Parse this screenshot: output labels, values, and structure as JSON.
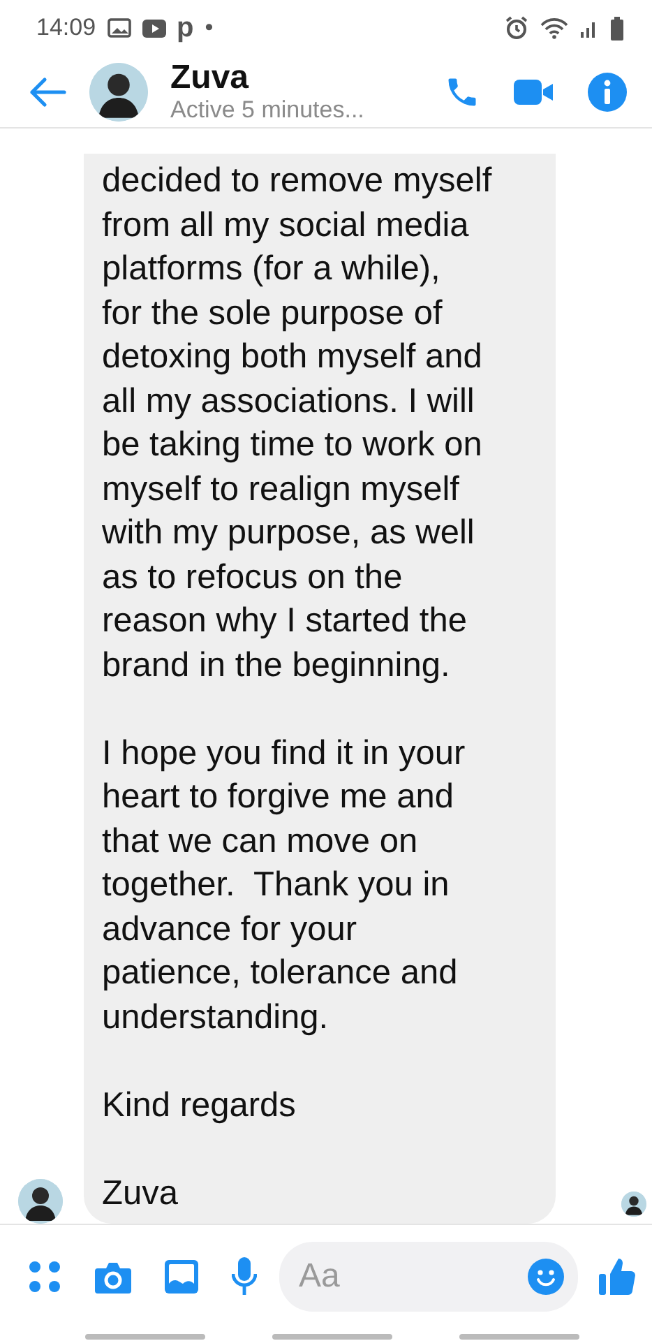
{
  "status_bar": {
    "time": "14:09",
    "app_letter": "p",
    "dot": "•"
  },
  "header": {
    "name": "Zuva",
    "presence": "Active 5 minutes..."
  },
  "message": {
    "paragraphs": [
      [
        "decided to remove myself",
        "from all my social media",
        "platforms (for a while),",
        "for the sole purpose of",
        "detoxing both myself and",
        "all my associations. I will",
        "be taking time to work on",
        "myself to realign myself",
        "with my purpose, as well",
        "as to refocus on the",
        "reason why I started the",
        "brand in the beginning."
      ],
      [
        "I hope you find it in your",
        "heart to forgive me and",
        "that we can move on",
        "together.  Thank you in",
        "advance for your",
        "patience, tolerance and",
        "understanding."
      ],
      [
        "Kind regards"
      ],
      [
        "Zuva"
      ]
    ],
    "seen": true
  },
  "composer": {
    "placeholder": "Aa"
  }
}
